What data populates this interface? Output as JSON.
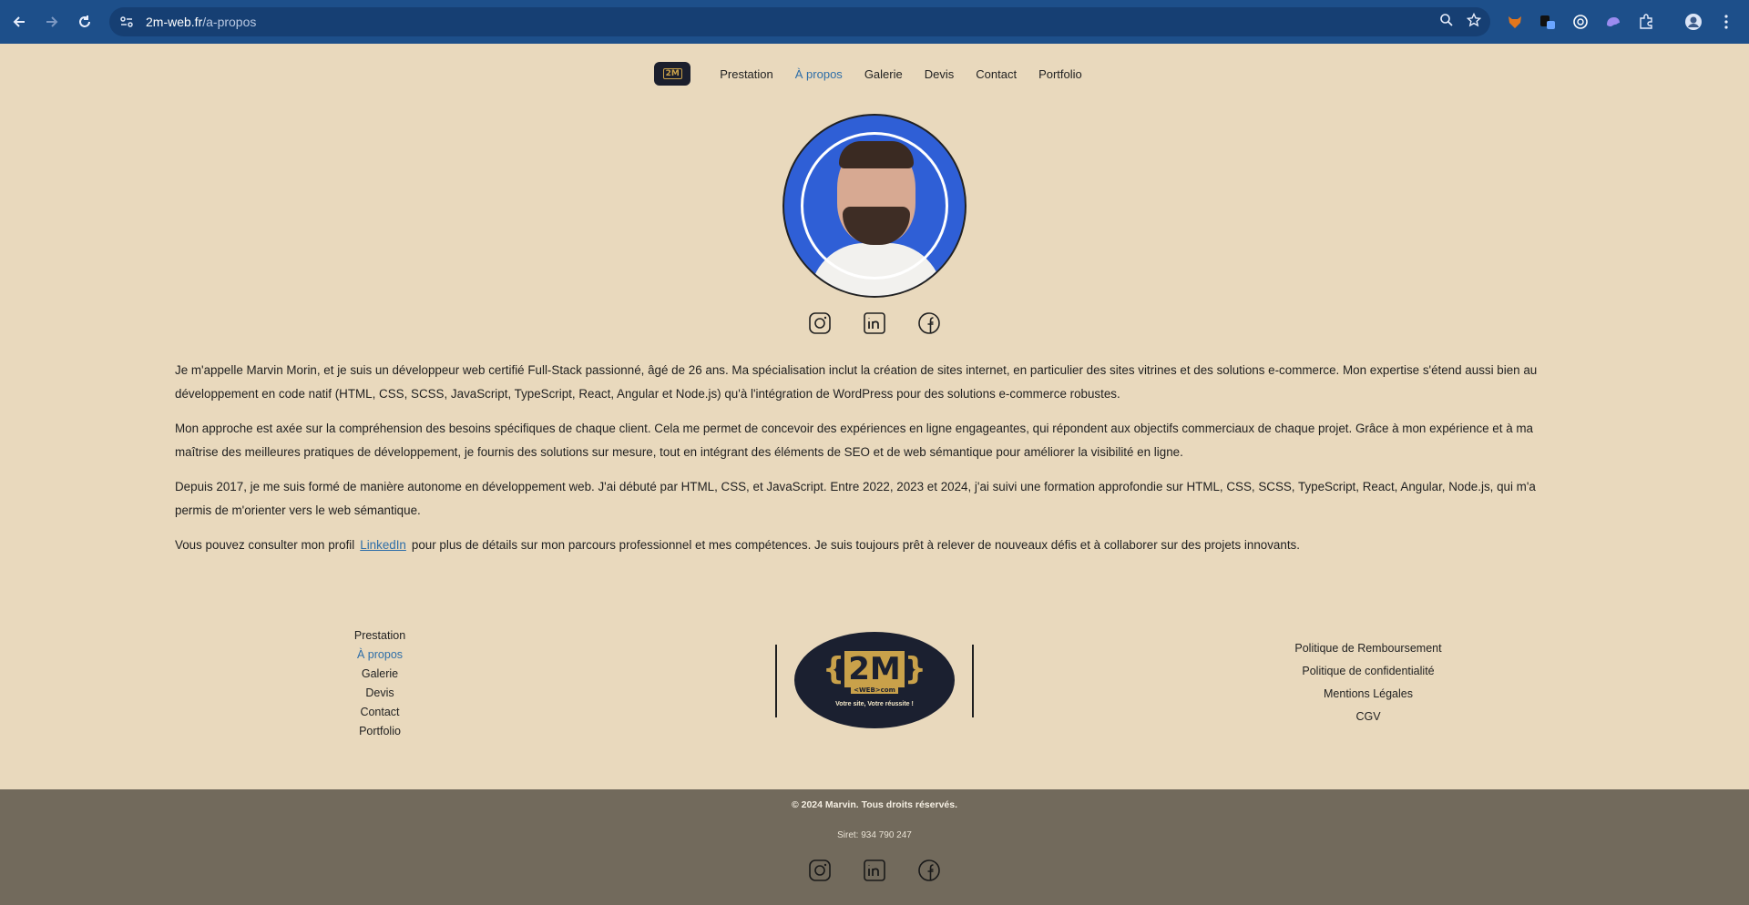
{
  "browser": {
    "url_domain": "2m-web.fr",
    "url_path": "/a-propos",
    "extensions": [
      "fox-extension-icon",
      "toggle-extension-icon",
      "chatgpt-extension-icon",
      "ghost-extension-icon",
      "puzzle-icon"
    ]
  },
  "nav": {
    "logo_text": "2M",
    "items": [
      {
        "label": "Prestation",
        "active": false
      },
      {
        "label": "À propos",
        "active": true
      },
      {
        "label": "Galerie",
        "active": false
      },
      {
        "label": "Devis",
        "active": false
      },
      {
        "label": "Contact",
        "active": false
      },
      {
        "label": "Portfolio",
        "active": false
      }
    ]
  },
  "about": {
    "p1": "Je m'appelle Marvin Morin, et je suis un développeur web certifié Full-Stack passionné, âgé de 26 ans. Ma spécialisation inclut la création de sites internet, en particulier des sites vitrines et des solutions e-commerce. Mon expertise s'étend aussi bien au développement en code natif (HTML, CSS, SCSS, JavaScript, TypeScript, React, Angular et Node.js) qu'à l'intégration de WordPress pour des solutions e-commerce robustes.",
    "p2": "Mon approche est axée sur la compréhension des besoins spécifiques de chaque client. Cela me permet de concevoir des expériences en ligne engageantes, qui répondent aux objectifs commerciaux de chaque projet. Grâce à mon expérience et à ma maîtrise des meilleures pratiques de développement, je fournis des solutions sur mesure, tout en intégrant des éléments de SEO et de web sémantique pour améliorer la visibilité en ligne.",
    "p3": "Depuis 2017, je me suis formé de manière autonome en développement web. J'ai débuté par HTML, CSS, et JavaScript. Entre 2022, 2023 et 2024, j'ai suivi une formation approfondie sur HTML, CSS, SCSS, TypeScript, React, Angular, Node.js, qui m'a permis de m'orienter vers le web sémantique.",
    "p4_before": "Vous pouvez consulter mon profil",
    "p4_link": "LinkedIn",
    "p4_after": "pour plus de détails sur mon parcours professionnel et mes compétences. Je suis toujours prêt à relever de nouveaux défis et à collaborer sur des projets innovants."
  },
  "footer": {
    "nav": [
      "Prestation",
      "À propos",
      "Galerie",
      "Devis",
      "Contact",
      "Portfolio"
    ],
    "logo_mark_left": "{",
    "logo_mark": "2M",
    "logo_mark_right": "}",
    "logo_sub": "<WEB>com",
    "logo_tagline": "Votre site, Votre réussite !",
    "legal": [
      "Politique de Remboursement",
      "Politique de confidentialité",
      "Mentions Légales",
      "CGV"
    ],
    "copyright": "© 2024 Marvin. Tous droits réservés.",
    "siret": "Siret: 934 790 247"
  },
  "colors": {
    "background": "#e9d9bd",
    "accent_link": "#2e6ea8",
    "footer_bar": "#726a5c",
    "browser_bar": "#1d4f8a"
  }
}
